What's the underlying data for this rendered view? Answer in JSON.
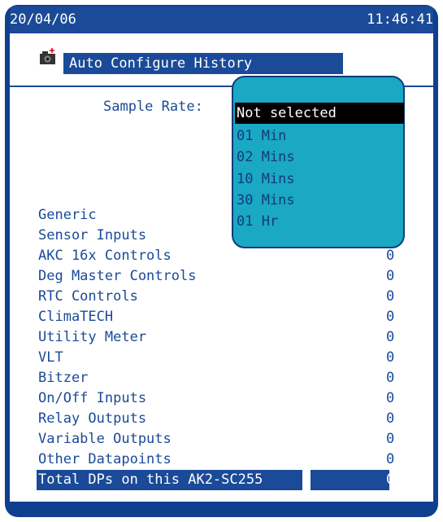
{
  "header": {
    "date": "20/04/06",
    "time": "11:46:41"
  },
  "title": {
    "icon": "camera-icon",
    "text": "Auto Configure History"
  },
  "sample_rate": {
    "label": "Sample Rate:",
    "options": [
      "Not selected",
      "01 Min",
      "02 Mins",
      "10 Mins",
      "30 Mins",
      "01 Hr"
    ],
    "selected": "Not selected"
  },
  "rows": [
    {
      "label": "Generic",
      "value": ""
    },
    {
      "label": "Sensor Inputs",
      "value": ""
    },
    {
      "label": "AKC 16x Controls",
      "value": "0"
    },
    {
      "label": "Deg Master Controls",
      "value": "0"
    },
    {
      "label": "RTC Controls",
      "value": "0"
    },
    {
      "label": "ClimaTECH",
      "value": "0"
    },
    {
      "label": "Utility Meter",
      "value": "0"
    },
    {
      "label": "VLT",
      "value": "0"
    },
    {
      "label": "Bitzer",
      "value": "0"
    },
    {
      "label": "On/Off Inputs",
      "value": "0"
    },
    {
      "label": "Relay Outputs",
      "value": "0"
    },
    {
      "label": "Variable Outputs",
      "value": "0"
    },
    {
      "label": "Other Datapoints",
      "value": "0"
    }
  ],
  "total": {
    "label": "Total DPs on this AK2-SC255",
    "value": "0"
  },
  "colors": {
    "navy": "#1a4a98",
    "frame": "#0f3f8e",
    "popup": "#1aa8c4"
  }
}
